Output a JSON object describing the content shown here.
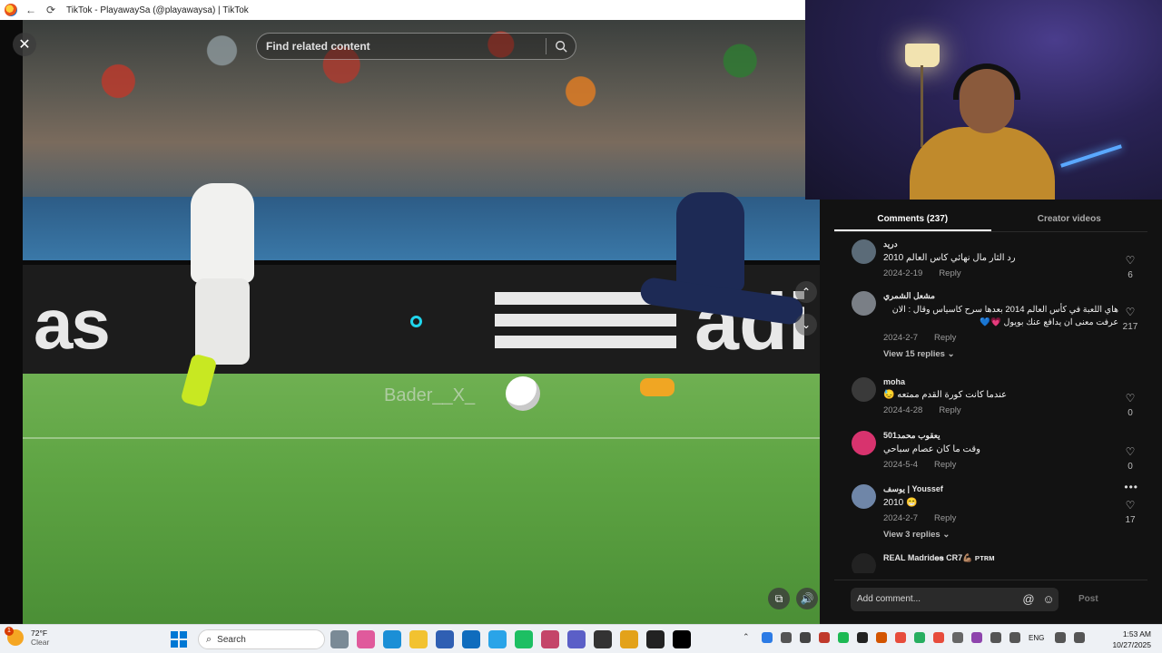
{
  "browser": {
    "title": "TikTok - PlayawaySa (@playawaysa) | TikTok",
    "back_icon": "←",
    "reload_icon": "⟳"
  },
  "video": {
    "search_placeholder": "Find related content",
    "watermark": "Bader__X_",
    "close_icon": "✕",
    "nav_up": "⌃",
    "nav_down": "⌄"
  },
  "comments_panel": {
    "tabs": [
      "Comments (237)",
      "Creator videos"
    ],
    "comments": [
      {
        "user": "دريد",
        "text": "رد الثار مال نهائي كاس العالم 2010",
        "date": "2024-2-19",
        "reply": "Reply",
        "likes": "6",
        "avatar_color": "#5b6b78"
      },
      {
        "user": "مشعل الشمري",
        "text": "هاي اللعبة في كأس العالم 2014 بعدها سرح كاسياس وقال : الان عرفت معنى ان يدافع عنك بويول 💗💙",
        "date": "2024-2-7",
        "reply": "Reply",
        "likes": "217",
        "replies": "View 15 replies",
        "avatar_color": "#7a7f86"
      },
      {
        "user": "moha",
        "text": "عندما كانت كورة القدم ممتعه 😓",
        "date": "2024-4-28",
        "reply": "Reply",
        "likes": "0",
        "avatar_color": "#3a3a3a"
      },
      {
        "user": "501يعقوب محمد",
        "text": "وقت ما كان عصام سباحي",
        "date": "2024-5-4",
        "reply": "Reply",
        "likes": "0",
        "avatar_color": "#d8336e"
      },
      {
        "user": "يوسف | Youssef",
        "text": "2010 😁",
        "date": "2024-2-7",
        "reply": "Reply",
        "likes": "17",
        "replies": "View 3 replies",
        "avatar_color": "#6f86a8"
      },
      {
        "user": "REAL Madrid𝐞𝐬 CR7💪🏽 ᴘᴛʀᴍ",
        "text": "",
        "date": "",
        "reply": "",
        "likes": "",
        "avatar_color": "#222"
      }
    ],
    "more_icon": "•••",
    "add_comment_placeholder": "Add comment...",
    "mention_icon": "@",
    "emoji_icon": "☺",
    "post_label": "Post"
  },
  "taskbar": {
    "weather_temp": "72°F",
    "weather_cond": "Clear",
    "weather_badge": "1",
    "search_label": "Search",
    "lang": "ENG",
    "time": "1:53 AM",
    "date": "10/27/2025"
  }
}
